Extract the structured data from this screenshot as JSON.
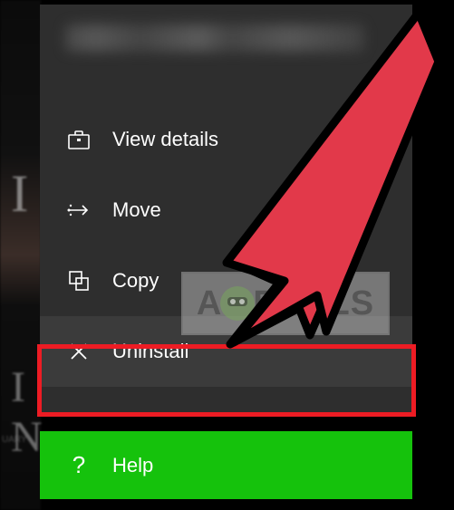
{
  "background": {
    "left_letter_top": "I",
    "left_letter_mid": "I N",
    "left_small_text": "UARY"
  },
  "menu": {
    "title_obscured": true,
    "items": [
      {
        "label": "View details",
        "icon": "briefcase"
      },
      {
        "label": "Move",
        "icon": "move-arrow"
      },
      {
        "label": "Copy",
        "icon": "copy-squares"
      },
      {
        "label": "Uninstall",
        "icon": "x",
        "highlighted": true
      }
    ]
  },
  "help": {
    "label": "Help",
    "icon": "?"
  },
  "watermark": {
    "text_left": "A",
    "text_right": "PUALS"
  },
  "overlay": {
    "arrow_color": "#e2394a",
    "highlight_color": "#ed1c24",
    "help_bg": "#15c20c"
  }
}
